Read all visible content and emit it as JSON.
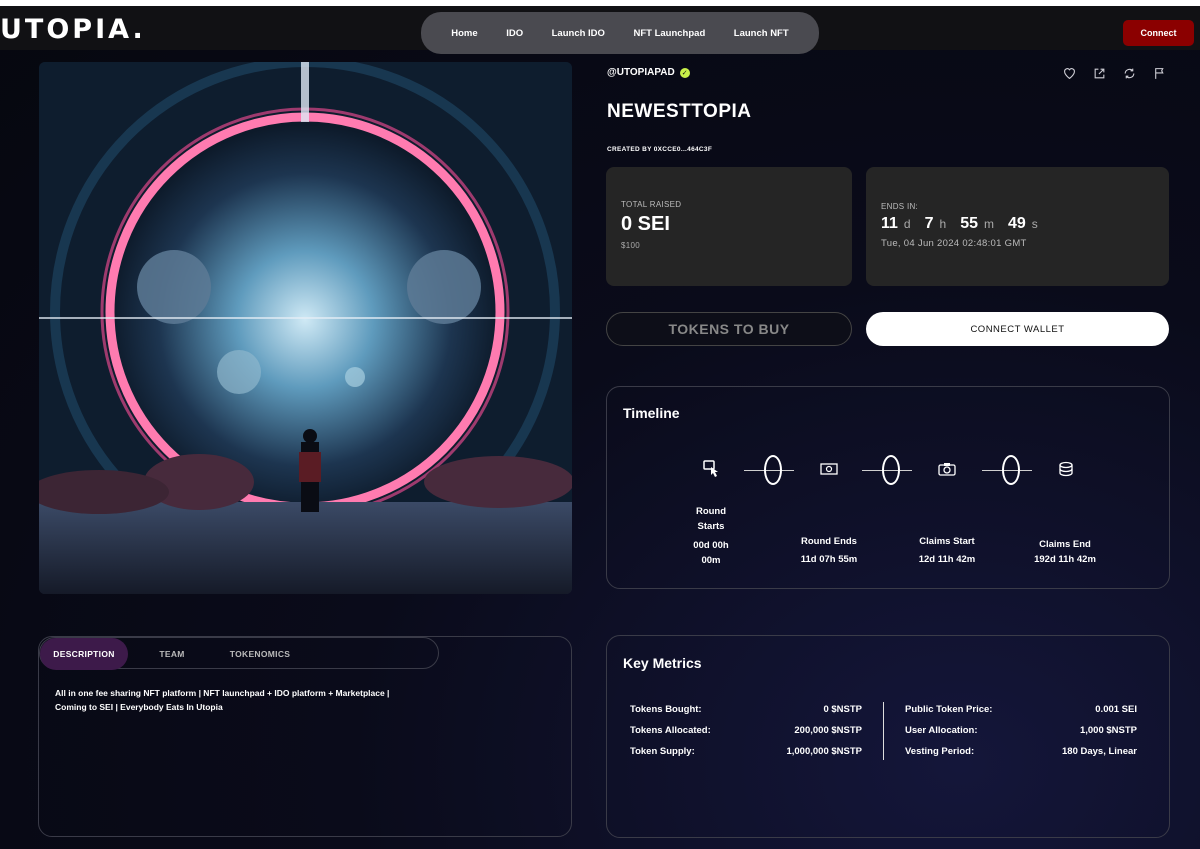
{
  "header": {
    "logo": "UTOPIA.",
    "nav": [
      "Home",
      "IDO",
      "Launch IDO",
      "NFT Launchpad",
      "Launch NFT"
    ],
    "connect_label": "Connect"
  },
  "project": {
    "handle": "@UTOPIAPAD",
    "title": "NEWESTTOPIA",
    "creator": "CREATED BY 0XCCE0...464C3F",
    "actions": [
      "heart-icon",
      "share-icon",
      "refresh-icon",
      "flag-icon"
    ]
  },
  "raised": {
    "label": "TOTAL RAISED",
    "value": "0 SEI",
    "usd": "$100"
  },
  "ends": {
    "label": "ENDS IN:",
    "days": "11",
    "days_unit": "d",
    "hours": "7",
    "hours_unit": "h",
    "minutes": "55",
    "minutes_unit": "m",
    "seconds": "49",
    "seconds_unit": "s",
    "date": "Tue, 04 Jun 2024 02:48:01 GMT"
  },
  "buttons": {
    "tokens_to_buy": "TOKENS TO BUY",
    "connect_wallet": "CONNECT WALLET"
  },
  "timeline": {
    "title": "Timeline",
    "steps": [
      {
        "label_line1": "Round",
        "label_line2": "Starts",
        "time_line1": "00d 00h",
        "time_line2": "00m",
        "icon": "hand-pointer-icon"
      },
      {
        "label_line1": "Round Ends",
        "label_line2": "",
        "time_line1": "11d 07h 55m",
        "time_line2": "",
        "icon": "cash-icon"
      },
      {
        "label_line1": "Claims Start",
        "label_line2": "",
        "time_line1": "12d 11h 42m",
        "time_line2": "",
        "icon": "camera-icon"
      },
      {
        "label_line1": "Claims End",
        "label_line2": "",
        "time_line1": "192d 11h 42m",
        "time_line2": "",
        "icon": "coins-icon"
      }
    ]
  },
  "description": {
    "tabs": [
      "DESCRIPTION",
      "TEAM",
      "TOKENOMICS"
    ],
    "active_tab": "DESCRIPTION",
    "line1": "All in one fee sharing NFT platform | NFT launchpad + IDO platform + Marketplace |",
    "line2": "Coming to SEI | Everybody Eats In Utopia"
  },
  "metrics": {
    "title": "Key Metrics",
    "left": [
      {
        "label": "Tokens Bought:",
        "value": "0 $NSTP"
      },
      {
        "label": "Tokens Allocated:",
        "value": "200,000 $NSTP"
      },
      {
        "label": "Token Supply:",
        "value": "1,000,000 $NSTP"
      }
    ],
    "right": [
      {
        "label": "Public Token Price:",
        "value": "0.001 SEI"
      },
      {
        "label": "User Allocation:",
        "value": "1,000 $NSTP"
      },
      {
        "label": "Vesting Period:",
        "value": "180 Days, Linear"
      }
    ]
  },
  "colors": {
    "accent_red": "#8b0000",
    "verified": "#c8f04a",
    "active_tab": "#3d1a4a",
    "card": "#252525"
  }
}
